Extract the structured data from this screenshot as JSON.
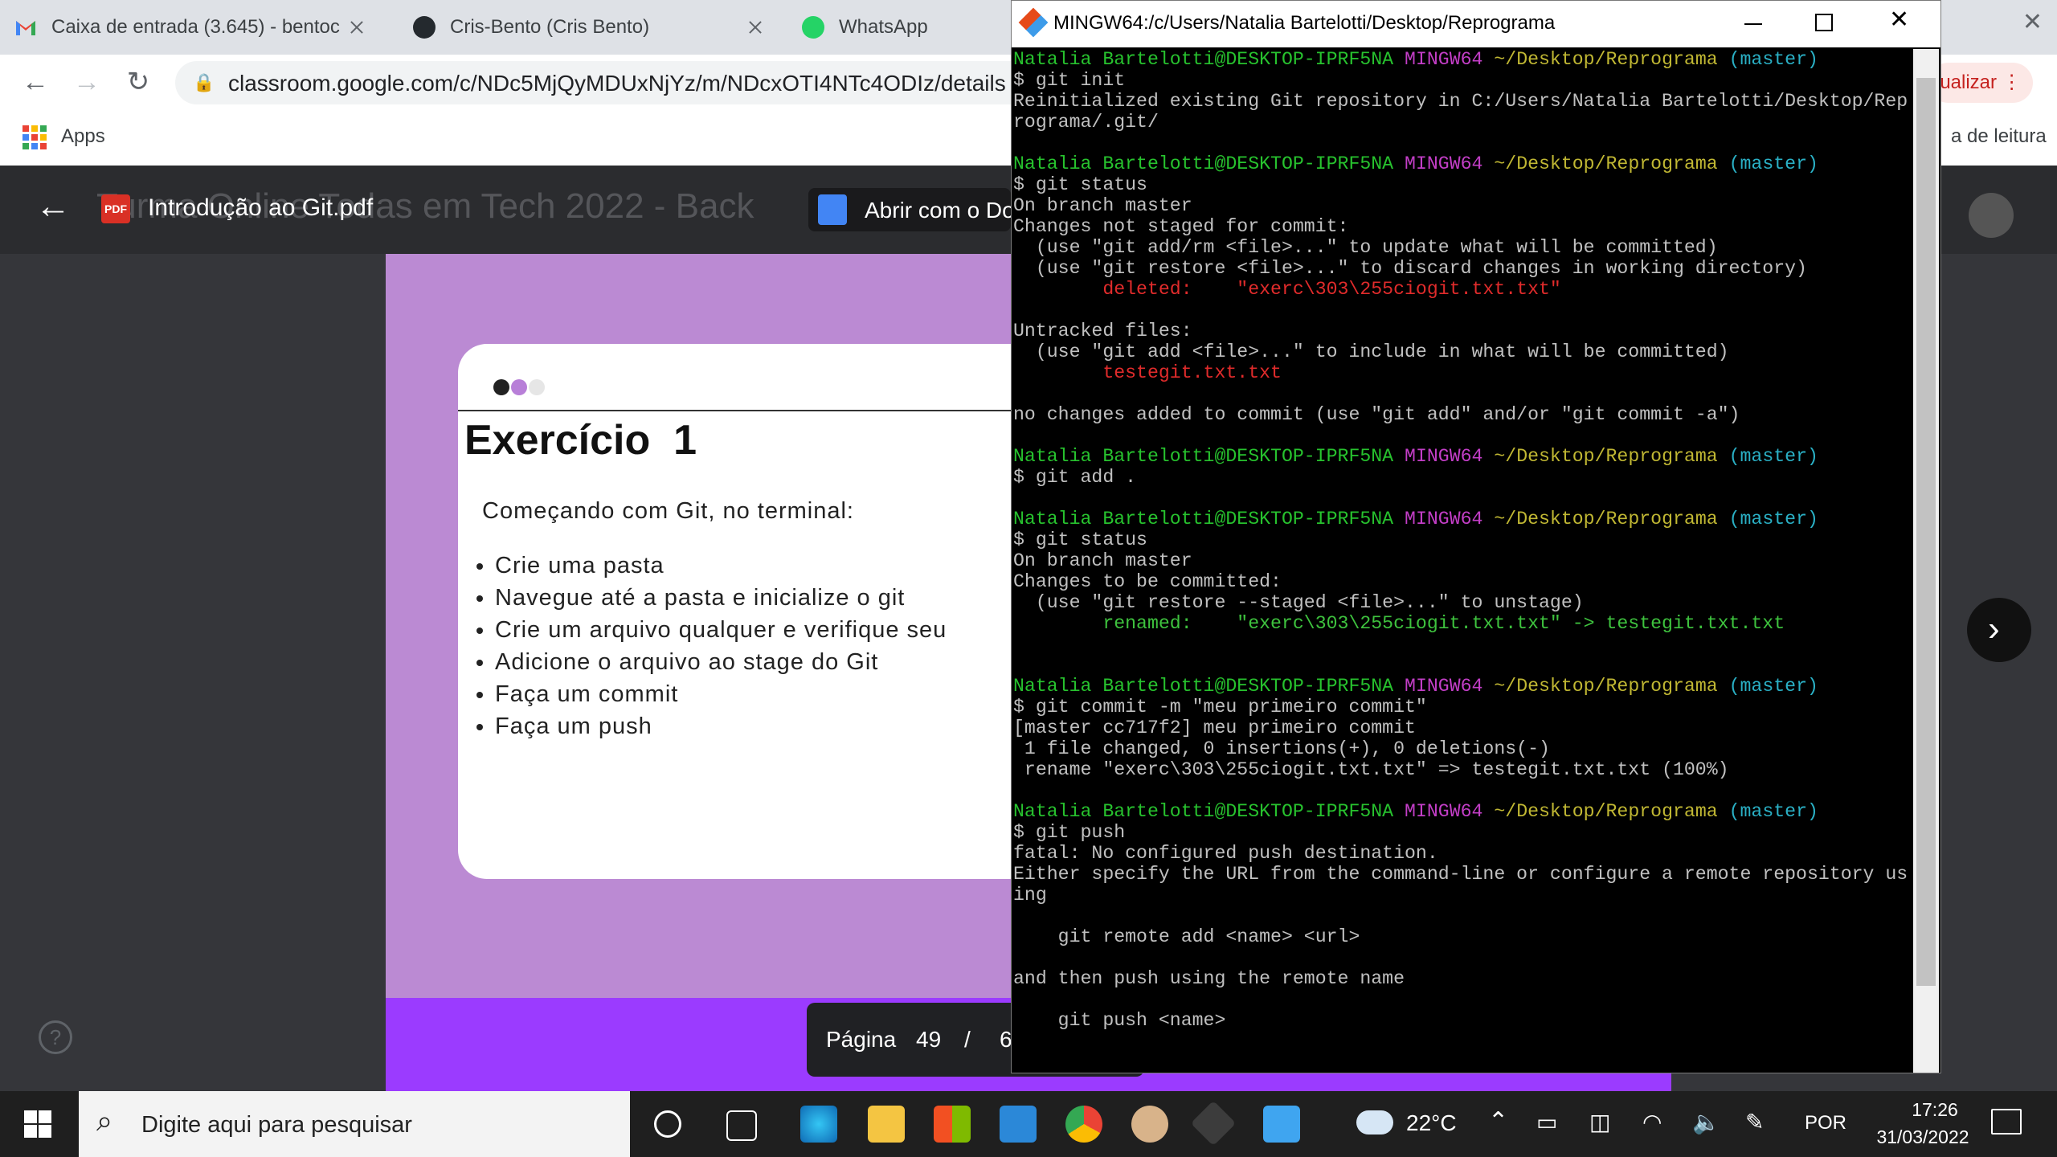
{
  "browser": {
    "tabs": [
      {
        "title": "Caixa de entrada (3.645) - bentoc",
        "icon": "gmail-icon"
      },
      {
        "title": "Cris-Bento (Cris Bento)",
        "icon": "github-icon"
      },
      {
        "title": "WhatsApp",
        "icon": "whatsapp-icon"
      }
    ],
    "url": "classroom.google.com/c/NDc5MjQyMDUxNjYz/m/NDcxOTI4NTc4ODIz/details",
    "bookmarks": {
      "apps": "Apps",
      "reading_list": "a de leitura"
    },
    "update_button": "ualizar"
  },
  "viewer": {
    "file_name": "Introdução ao Git.pdf",
    "file_badge": "PDF",
    "background_title": "Turma Online Todas em Tech 2022 - Back",
    "open_with": "Abrir com o Doc",
    "slide": {
      "heading": "Exercício  1",
      "intro": "Começando com Git, no terminal:",
      "bullets": [
        "Crie uma pasta",
        "Navegue até a pasta e inicialize o git",
        "Crie um arquivo qualquer e verifique seu",
        "Adicione o arquivo ao stage do Git",
        "Faça um commit",
        "Faça um push"
      ]
    },
    "pager": {
      "label": "Página",
      "current": "49",
      "separator": "/",
      "total": "6"
    },
    "help": "?"
  },
  "terminal": {
    "title": "MINGW64:/c/Users/Natalia Bartelotti/Desktop/Reprograma",
    "prompt": {
      "user": "Natalia Bartelotti@DESKTOP-IPRF5NA",
      "shell": "MINGW64",
      "path": "~/Desktop/Reprograma",
      "branch": "(master)"
    },
    "lines": [
      {
        "k": "prompt"
      },
      {
        "k": "text",
        "t": "$ git init"
      },
      {
        "k": "text",
        "t": "Reinitialized existing Git repository in C:/Users/Natalia Bartelotti/Desktop/Rep"
      },
      {
        "k": "text",
        "t": "rograma/.git/"
      },
      {
        "k": "blank"
      },
      {
        "k": "prompt"
      },
      {
        "k": "text",
        "t": "$ git status"
      },
      {
        "k": "text",
        "t": "On branch master"
      },
      {
        "k": "text",
        "t": "Changes not staged for commit:"
      },
      {
        "k": "text",
        "t": "  (use \"git add/rm <file>...\" to update what will be committed)"
      },
      {
        "k": "text",
        "t": "  (use \"git restore <file>...\" to discard changes in working directory)"
      },
      {
        "k": "red",
        "t": "        deleted:    \"exerc\\303\\255ciogit.txt.txt\""
      },
      {
        "k": "blank"
      },
      {
        "k": "text",
        "t": "Untracked files:"
      },
      {
        "k": "text",
        "t": "  (use \"git add <file>...\" to include in what will be committed)"
      },
      {
        "k": "red",
        "t": "        testegit.txt.txt"
      },
      {
        "k": "blank"
      },
      {
        "k": "text",
        "t": "no changes added to commit (use \"git add\" and/or \"git commit -a\")"
      },
      {
        "k": "blank"
      },
      {
        "k": "prompt"
      },
      {
        "k": "text",
        "t": "$ git add ."
      },
      {
        "k": "blank"
      },
      {
        "k": "prompt"
      },
      {
        "k": "text",
        "t": "$ git status"
      },
      {
        "k": "text",
        "t": "On branch master"
      },
      {
        "k": "text",
        "t": "Changes to be committed:"
      },
      {
        "k": "text",
        "t": "  (use \"git restore --staged <file>...\" to unstage)"
      },
      {
        "k": "green",
        "t": "        renamed:    \"exerc\\303\\255ciogit.txt.txt\" -> testegit.txt.txt"
      },
      {
        "k": "blank"
      },
      {
        "k": "blank"
      },
      {
        "k": "prompt"
      },
      {
        "k": "text",
        "t": "$ git commit -m \"meu primeiro commit\""
      },
      {
        "k": "text",
        "t": "[master cc717f2] meu primeiro commit"
      },
      {
        "k": "text",
        "t": " 1 file changed, 0 insertions(+), 0 deletions(-)"
      },
      {
        "k": "text",
        "t": " rename \"exerc\\303\\255ciogit.txt.txt\" => testegit.txt.txt (100%)"
      },
      {
        "k": "blank"
      },
      {
        "k": "prompt"
      },
      {
        "k": "text",
        "t": "$ git push"
      },
      {
        "k": "text",
        "t": "fatal: No configured push destination."
      },
      {
        "k": "text",
        "t": "Either specify the URL from the command-line or configure a remote repository us"
      },
      {
        "k": "text",
        "t": "ing"
      },
      {
        "k": "blank"
      },
      {
        "k": "text",
        "t": "    git remote add <name> <url>"
      },
      {
        "k": "blank"
      },
      {
        "k": "text",
        "t": "and then push using the remote name"
      },
      {
        "k": "blank"
      },
      {
        "k": "text",
        "t": "    git push <name>"
      }
    ]
  },
  "taskbar": {
    "search_placeholder": "Digite aqui para pesquisar",
    "weather": "22°C",
    "language": "POR",
    "time": "17:26",
    "date": "31/03/2022"
  },
  "colors": {
    "slide_purple": "#bb8ad3",
    "accent_purple": "#9b3bff",
    "term_green": "#27c22e",
    "term_magenta": "#c33ec7",
    "term_yellow": "#c0b733",
    "term_cyan": "#2ab0c5"
  }
}
